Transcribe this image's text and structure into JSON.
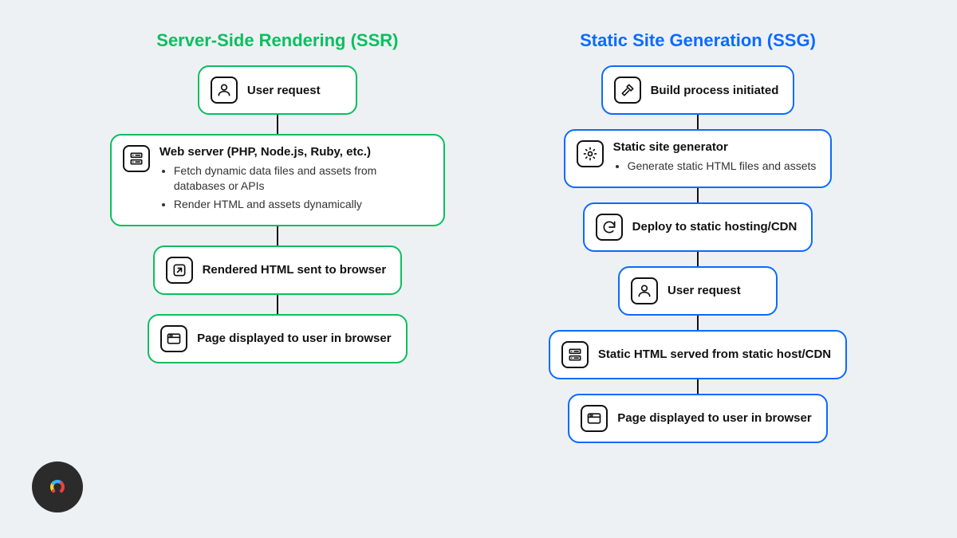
{
  "ssr": {
    "title": "Server-Side Rendering (SSR)",
    "steps": [
      {
        "icon": "user-icon",
        "title": "User request",
        "bullets": []
      },
      {
        "icon": "server-icon",
        "title": "Web server (PHP, Node.js, Ruby, etc.)",
        "bullets": [
          "Fetch dynamic data files and assets from databases or APIs",
          "Render HTML and assets dynamically"
        ]
      },
      {
        "icon": "send-icon",
        "title": "Rendered HTML sent to browser",
        "bullets": []
      },
      {
        "icon": "browser-icon",
        "title": "Page displayed to user in browser",
        "bullets": []
      }
    ]
  },
  "ssg": {
    "title": "Static Site Generation (SSG)",
    "steps": [
      {
        "icon": "hammer-icon",
        "title": "Build process initiated",
        "bullets": []
      },
      {
        "icon": "gear-icon",
        "title": "Static site generator",
        "bullets": [
          "Generate static HTML files and assets"
        ]
      },
      {
        "icon": "sync-icon",
        "title": "Deploy to static hosting/CDN",
        "bullets": []
      },
      {
        "icon": "user-icon",
        "title": "User request",
        "bullets": []
      },
      {
        "icon": "server-icon",
        "title": "Static HTML served from static host/CDN",
        "bullets": []
      },
      {
        "icon": "browser-icon",
        "title": "Page displayed to user in browser",
        "bullets": []
      }
    ]
  }
}
